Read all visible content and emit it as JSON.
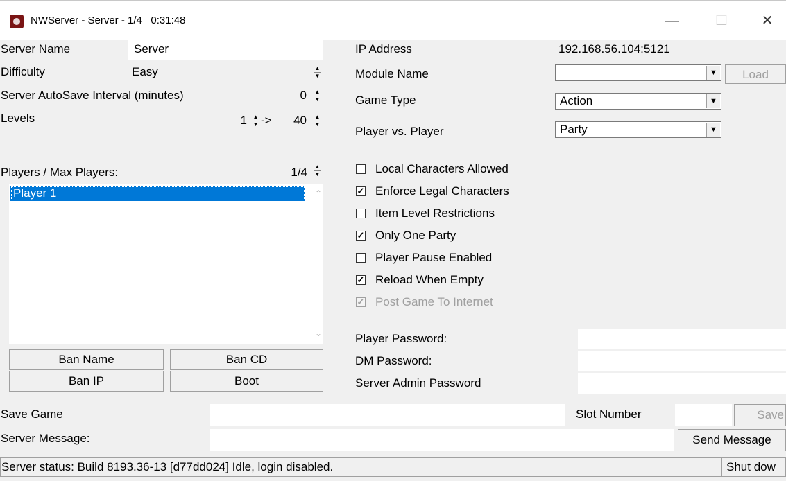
{
  "window": {
    "title": "NWServer - Server - 1/4",
    "timer": "0:31:48",
    "minimize_glyph": "—",
    "maximize_glyph": "☐",
    "close_glyph": "✕"
  },
  "left": {
    "server_name_label": "Server Name",
    "server_name_value": "Server",
    "difficulty_label": "Difficulty",
    "difficulty_value": "Easy",
    "autosave_label": "Server AutoSave Interval (minutes)",
    "autosave_value": "0",
    "levels_label": "Levels",
    "levels_min": "1",
    "levels_arrow": "->",
    "levels_max": "40",
    "players_label": "Players / Max Players:",
    "players_value": "1/4",
    "players": [
      "Player 1"
    ],
    "ban_name": "Ban Name",
    "ban_cd": "Ban CD",
    "ban_ip": "Ban IP",
    "boot": "Boot"
  },
  "right": {
    "ip_label": "IP Address",
    "ip_value": "192.168.56.104:5121",
    "module_label": "Module Name",
    "module_value": "",
    "load_button": "Load",
    "game_type_label": "Game Type",
    "game_type_value": "Action",
    "pvp_label": "Player vs. Player",
    "pvp_value": "Party",
    "options": [
      {
        "label": "Local Characters Allowed",
        "checked": false,
        "enabled": true
      },
      {
        "label": "Enforce Legal Characters",
        "checked": true,
        "enabled": true
      },
      {
        "label": "Item Level Restrictions",
        "checked": false,
        "enabled": true
      },
      {
        "label": "Only One Party",
        "checked": true,
        "enabled": true
      },
      {
        "label": "Player Pause Enabled",
        "checked": false,
        "enabled": true
      },
      {
        "label": "Reload When Empty",
        "checked": true,
        "enabled": true
      },
      {
        "label": "Post Game To Internet",
        "checked": true,
        "enabled": false
      }
    ],
    "player_password_label": "Player Password:",
    "dm_password_label": "DM Password:",
    "admin_password_label": "Server Admin Password"
  },
  "bottom": {
    "save_game_label": "Save Game",
    "slot_number_label": "Slot Number",
    "save_button": "Save",
    "server_message_label": "Server Message:",
    "send_message_button": "Send Message",
    "status_text": "Server status: Build 8193.36-13 [d77dd024] Idle, login disabled.",
    "shutdown_button": "Shut dow"
  }
}
